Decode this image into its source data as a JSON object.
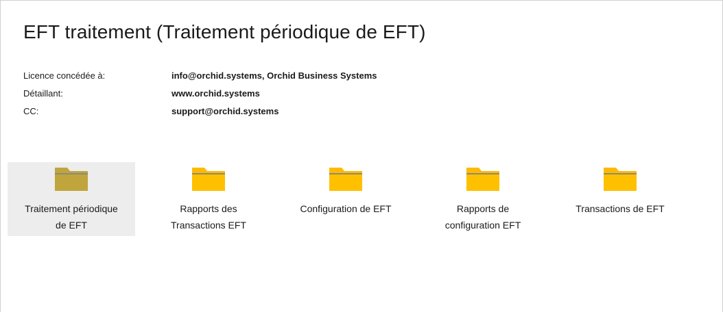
{
  "header": {
    "title": "EFT traitement (Traitement périodique de EFT)"
  },
  "license_info": [
    {
      "label": "Licence concédée à:",
      "value": "info@orchid.systems, Orchid Business Systems"
    },
    {
      "label": "Détaillant:",
      "value": "www.orchid.systems"
    },
    {
      "label": "CC:",
      "value": "support@orchid.systems"
    }
  ],
  "folders": [
    {
      "label": "Traitement périodique\nde EFT",
      "icon": "folder-icon",
      "selected": true
    },
    {
      "label": "Rapports des\nTransactions EFT",
      "icon": "folder-icon",
      "selected": false
    },
    {
      "label": "Configuration de EFT",
      "icon": "folder-icon",
      "selected": false
    },
    {
      "label": "Rapports de\nconfiguration EFT",
      "icon": "folder-icon",
      "selected": false
    },
    {
      "label": "Transactions de EFT",
      "icon": "folder-icon",
      "selected": false
    }
  ],
  "colors": {
    "folder_yellow": "#ffb900",
    "folder_selected": "#c0a53c",
    "selection_bg": "#ededed"
  }
}
